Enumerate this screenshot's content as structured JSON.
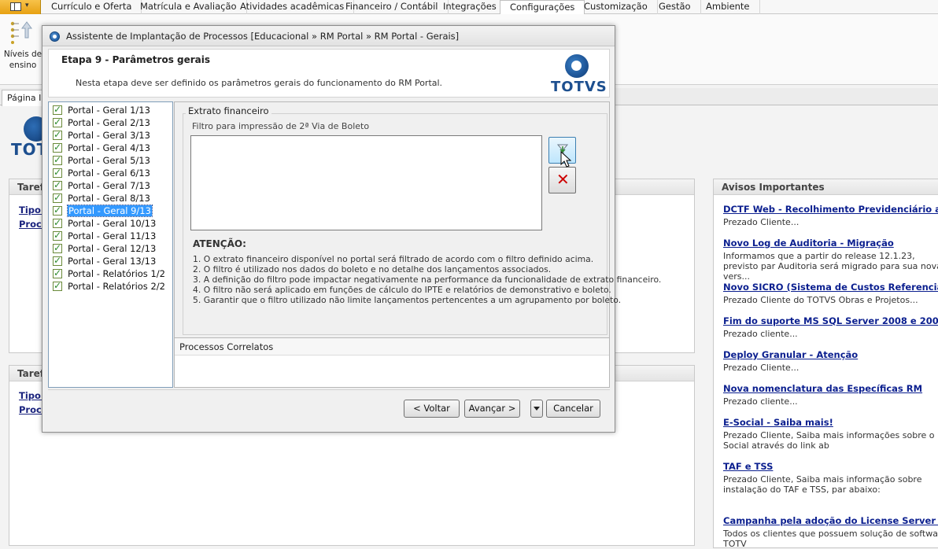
{
  "ribbon": {
    "tabs": [
      "Currículo e Oferta",
      "Matrícula e Avaliação",
      "Atividades acadêmicas",
      "Financeiro / Contábil",
      "Integrações",
      "Configurações",
      "Customização",
      "Gestão",
      "Ambiente"
    ],
    "active_tab": "Configurações",
    "group_button_label": "Níveis de ensino"
  },
  "page_tab": {
    "label": "Página Inicial"
  },
  "background": {
    "logo_text": "TOTVS",
    "panel1_title": "Tarefas",
    "panel1_links": [
      "Tipo de",
      "Proce"
    ],
    "panel2_title": "Tarefas",
    "panel2_links": [
      "Tipo de",
      "Proce"
    ],
    "avisos": {
      "title": "Avisos Importantes",
      "items": [
        {
          "title": "DCTF Web - Recolhimento Previdenciário agosto/",
          "desc": "Prezado Cliente..."
        },
        {
          "title": "Novo Log de Auditoria - Migração",
          "desc": "Informamos que a partir do release 12.1.23, previsto par Auditoria será migrado para sua nova vers..."
        },
        {
          "title": "Novo SICRO (Sistema de Custos Referenciais de O",
          "desc": "Prezado Cliente do TOTVS Obras e Projetos..."
        },
        {
          "title": "Fim do suporte MS SQL Server 2008 e 2008R2",
          "desc": "Prezado cliente..."
        },
        {
          "title": "Deploy Granular - Atenção",
          "desc": "Prezado Cliente..."
        },
        {
          "title": "Nova nomenclatura das Específicas RM",
          "desc": "Prezado cliente..."
        },
        {
          "title": "E-Social - Saiba mais!",
          "desc": "Prezado Cliente, Saiba mais informações sobre o E-Social através do link ab"
        },
        {
          "title": "TAF e TSS",
          "desc": "Prezado Cliente, Saiba mais informação sobre instalação do TAF e TSS, par abaixo:"
        },
        {
          "title": "Campanha pela adoção do License Server Virtual",
          "desc": "Todos os clientes que possuem solução de software TOTV"
        }
      ]
    }
  },
  "dialog": {
    "title": "Assistente de Implantação de Processos [Educacional » RM Portal » RM Portal - Gerais]",
    "step_title": "Etapa 9 - Parâmetros gerais",
    "step_desc": "Nesta etapa deve ser definido os parâmetros gerais do funcionamento do RM Portal.",
    "logo_text": "TOTVS",
    "steps": [
      "Portal - Geral 1/13",
      "Portal - Geral 2/13",
      "Portal - Geral 3/13",
      "Portal - Geral 4/13",
      "Portal - Geral 5/13",
      "Portal - Geral 6/13",
      "Portal - Geral 7/13",
      "Portal - Geral 8/13",
      "Portal - Geral 9/13",
      "Portal - Geral 10/13",
      "Portal - Geral 11/13",
      "Portal - Geral 12/13",
      "Portal - Geral 13/13",
      "Portal - Relatórios 1/2",
      "Portal - Relatórios 2/2"
    ],
    "selected_step_index": 8,
    "group_title": "Extrato financeiro",
    "filter_label": "Filtro para impressão de 2ª Via de Boleto",
    "filter_value": "",
    "attention_title": "ATENÇÃO:",
    "attention_items": [
      "1. O extrato financeiro disponível no portal será filtrado de acordo com o filtro definido acima.",
      "2. O filtro é utilizado nos dados do boleto e no detalhe dos lançamentos associados.",
      "3. A definição do filtro pode impactar negativamente na performance da funcionalidade de extrato financeiro.",
      "4. O filtro não será aplicado em funções de cálculo do IPTE e relatórios de demonstrativo e boleto.",
      "5. Garantir que o filtro utilizado não limite lançamentos pertencentes a um agrupamento por boleto."
    ],
    "related_title": "Processos Correlatos",
    "buttons": {
      "back": "< Voltar",
      "next": "Avançar >",
      "cancel": "Cancelar"
    }
  },
  "colors": {
    "accent": "#3399ff",
    "brand": "#1d4f8f",
    "link": "#0b1f8f",
    "app_menu": "#e7a112"
  }
}
